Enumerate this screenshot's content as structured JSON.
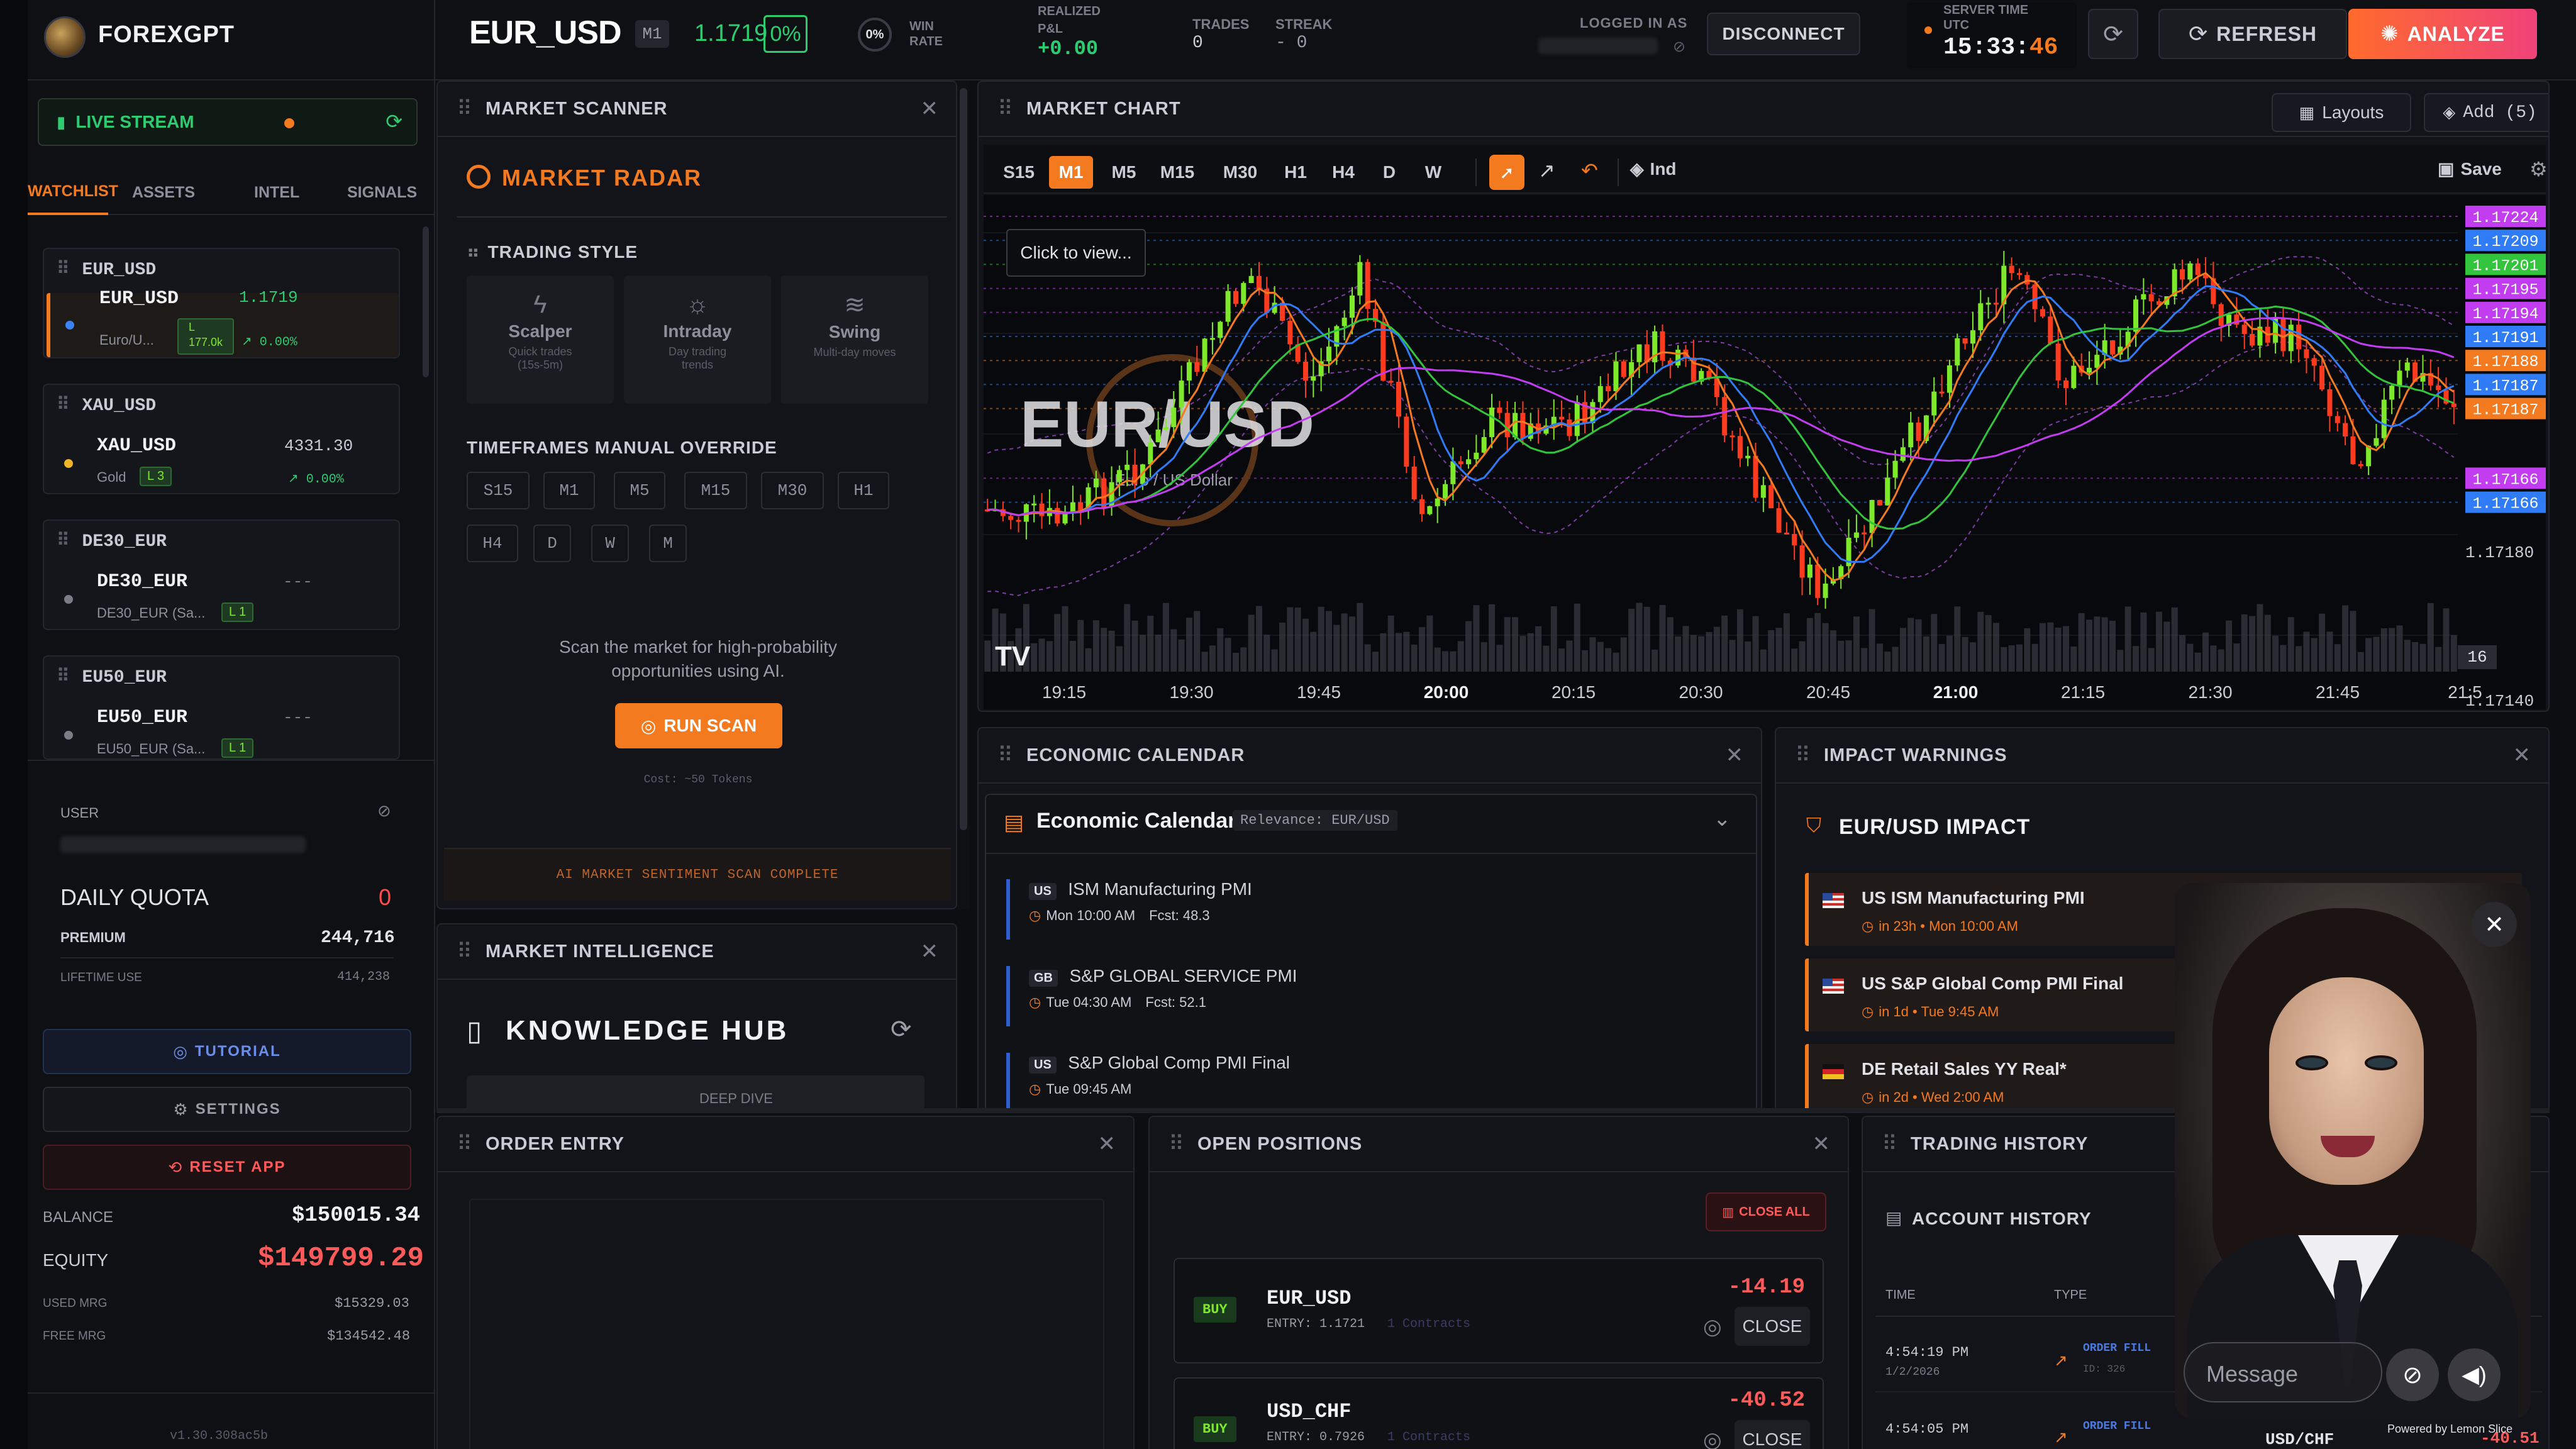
{
  "header": {
    "brand": "FOREXGPT",
    "symbol": "EUR_USD",
    "tf": "M1",
    "price": "1.1719",
    "change": "0%",
    "win_pct": "0%",
    "win_label_1": "WIN",
    "win_label_2": "RATE",
    "pnl_label_1": "REALIZED",
    "pnl_label_2": "P&L",
    "pnl_value": "+0.00",
    "trades_label": "TRADES",
    "trades_value": "0",
    "streak_label": "STREAK",
    "streak_value": "- 0",
    "logged_label": "LOGGED IN AS",
    "disconnect": "DISCONNECT",
    "server_label_1": "SERVER TIME",
    "server_label_2": "UTC",
    "server_time_hm": "15:33:",
    "server_time_s": "46",
    "refresh": "REFRESH",
    "analyze": "ANALYZE"
  },
  "sidebar": {
    "live": "LIVE STREAM",
    "tabs": [
      "WATCHLIST",
      "ASSETS",
      "INTEL",
      "SIGNALS"
    ],
    "watch": [
      {
        "head": "EUR_USD",
        "name": "EUR_USD",
        "price": "1.1719",
        "desc": "Euro/U...",
        "level": "L",
        "vol": "177.0k",
        "chg": "↗ 0.00%"
      },
      {
        "head": "XAU_USD",
        "name": "XAU_USD",
        "price": "4331.30",
        "desc": "Gold",
        "level": "L 3",
        "chg": "↗ 0.00%"
      },
      {
        "head": "DE30_EUR",
        "name": "DE30_EUR",
        "price": "---",
        "desc": "DE30_EUR (Sa...",
        "level": "L 1"
      },
      {
        "head": "EU50_EUR",
        "name": "EU50_EUR",
        "price": "---",
        "desc": "EU50_EUR (Sa...",
        "level": "L 1"
      }
    ],
    "user_label": "USER",
    "quota_label": "DAILY QUOTA",
    "quota_value": "0",
    "premium_label": "PREMIUM",
    "premium_value": "244,716",
    "lifetime_label": "LIFETIME USE",
    "lifetime_value": "414,238",
    "tutorial": "TUTORIAL",
    "settings": "SETTINGS",
    "reset": "RESET APP",
    "balance_label": "BALANCE",
    "balance_value": "$150015.34",
    "equity_label": "EQUITY",
    "equity_value": "$149799.29",
    "used_label": "USED MRG",
    "used_value": "$15329.03",
    "free_label": "FREE MRG",
    "free_value": "$134542.48",
    "version": "v1.30.308ac5b"
  },
  "scanner": {
    "title": "MARKET SCANNER",
    "radar": "MARKET RADAR",
    "style_label": "TRADING STYLE",
    "styles": [
      {
        "name": "Scalper",
        "desc1": "Quick trades",
        "desc2": "(15s-5m)"
      },
      {
        "name": "Intraday",
        "desc1": "Day trading",
        "desc2": "trends"
      },
      {
        "name": "Swing",
        "desc1": "Multi-day moves",
        "desc2": ""
      }
    ],
    "tf_label": "TIMEFRAMES MANUAL OVERRIDE",
    "tfs": [
      "S15",
      "M1",
      "M5",
      "M15",
      "M30",
      "H1",
      "H4",
      "D",
      "W",
      "M"
    ],
    "prompt1": "Scan the market for high-probability",
    "prompt2": "opportunities using AI.",
    "run": "RUN SCAN",
    "cost": "Cost: ~50 Tokens",
    "status": "AI MARKET SENTIMENT SCAN COMPLETE"
  },
  "intel": {
    "title": "MARKET INTELLIGENCE",
    "hub": "KNOWLEDGE HUB",
    "deep": "DEEP DIVE"
  },
  "chart": {
    "title": "MARKET CHART",
    "layouts": "Layouts",
    "add": "Add (5)",
    "tfs": [
      "S15",
      "M1",
      "M5",
      "M15",
      "M30",
      "H1",
      "H4",
      "D",
      "W"
    ],
    "ind": "Ind",
    "save": "Save",
    "click": "Click to view...",
    "watermark": "EUR/USD",
    "watermark_sub": "Euro / US Dollar",
    "tv": "TV",
    "vol_badge": "16"
  },
  "chart_data": {
    "type": "candlestick",
    "x": [
      "19:15",
      "19:30",
      "19:45",
      "20:00",
      "20:15",
      "20:30",
      "20:45",
      "21:00",
      "21:15",
      "21:30",
      "21:45",
      "21:5"
    ],
    "price_tags": [
      {
        "label": "1.17224",
        "color": "#c23cf0"
      },
      {
        "label": "1.17209",
        "color": "#2f7cf6"
      },
      {
        "label": "1.17201",
        "color": "#32c43c"
      },
      {
        "label": "1.17195",
        "color": "#c23cf0"
      },
      {
        "label": "1.17194",
        "color": "#c23cf0"
      },
      {
        "label": "1.17191",
        "color": "#2f7cf6"
      },
      {
        "label": "1.17188",
        "color": "#f47a20"
      },
      {
        "label": "1.17187",
        "color": "#2f7cf6"
      },
      {
        "label": "1.17187",
        "color": "#f47a20"
      },
      {
        "label": "1.17166",
        "color": "#c23cf0"
      },
      {
        "label": "1.17166",
        "color": "#2f7cf6"
      }
    ],
    "axis_ticks": [
      "1.17180",
      "1.17140"
    ],
    "colors": {
      "up": "#7ee82a",
      "down": "#ff3b1f"
    }
  },
  "calendar": {
    "title": "ECONOMIC CALENDAR",
    "heading": "Economic Calendar",
    "relevance": "Relevance: EUR/USD",
    "events": [
      {
        "cc": "US",
        "name": "ISM Manufacturing PMI",
        "time": "Mon 10:00 AM",
        "fcst": "Fcst: 48.3"
      },
      {
        "cc": "GB",
        "name": "S&P GLOBAL SERVICE PMI",
        "time": "Tue 04:30 AM",
        "fcst": "Fcst: 52.1"
      },
      {
        "cc": "US",
        "name": "S&P Global Comp PMI Final",
        "time": "Tue 09:45 AM",
        "fcst": ""
      }
    ]
  },
  "impact": {
    "title": "IMPACT WARNINGS",
    "heading": "EUR/USD IMPACT",
    "items": [
      {
        "name": "US ISM Manufacturing PMI",
        "when": "in 23h • Mon 10:00 AM",
        "flag": "us"
      },
      {
        "name": "US S&P Global Comp PMI Final",
        "when": "in 1d • Tue 9:45 AM",
        "flag": "us"
      },
      {
        "name": "DE Retail Sales YY Real*",
        "when": "in 2d • Wed 2:00 AM",
        "flag": "de"
      }
    ]
  },
  "order": {
    "title": "ORDER ENTRY"
  },
  "positions": {
    "title": "OPEN POSITIONS",
    "close_all": "CLOSE ALL",
    "items": [
      {
        "side": "BUY",
        "sym": "EUR_USD",
        "entry": "ENTRY: 1.1721",
        "contracts": "1 Contracts",
        "pnl": "-14.19",
        "close": "CLOSE"
      },
      {
        "side": "BUY",
        "sym": "USD_CHF",
        "entry": "ENTRY: 0.7926",
        "contracts": "1 Contracts",
        "pnl": "-40.52",
        "close": "CLOSE"
      }
    ]
  },
  "history": {
    "title": "TRADING HISTORY",
    "heading": "ACCOUNT HISTORY",
    "col_time": "TIME",
    "col_type": "TYPE",
    "rows": [
      {
        "time": "4:54:19 PM",
        "date": "1/2/2026",
        "type": "ORDER FILL",
        "id": "ID: 326"
      },
      {
        "time": "4:54:05 PM",
        "date": "",
        "type": "ORDER FILL",
        "id": "",
        "sym": "USD/CHF",
        "amt": "-40.51"
      }
    ]
  },
  "avatar": {
    "message_placeholder": "Message",
    "powered": "Powered by Lemon Slice"
  }
}
